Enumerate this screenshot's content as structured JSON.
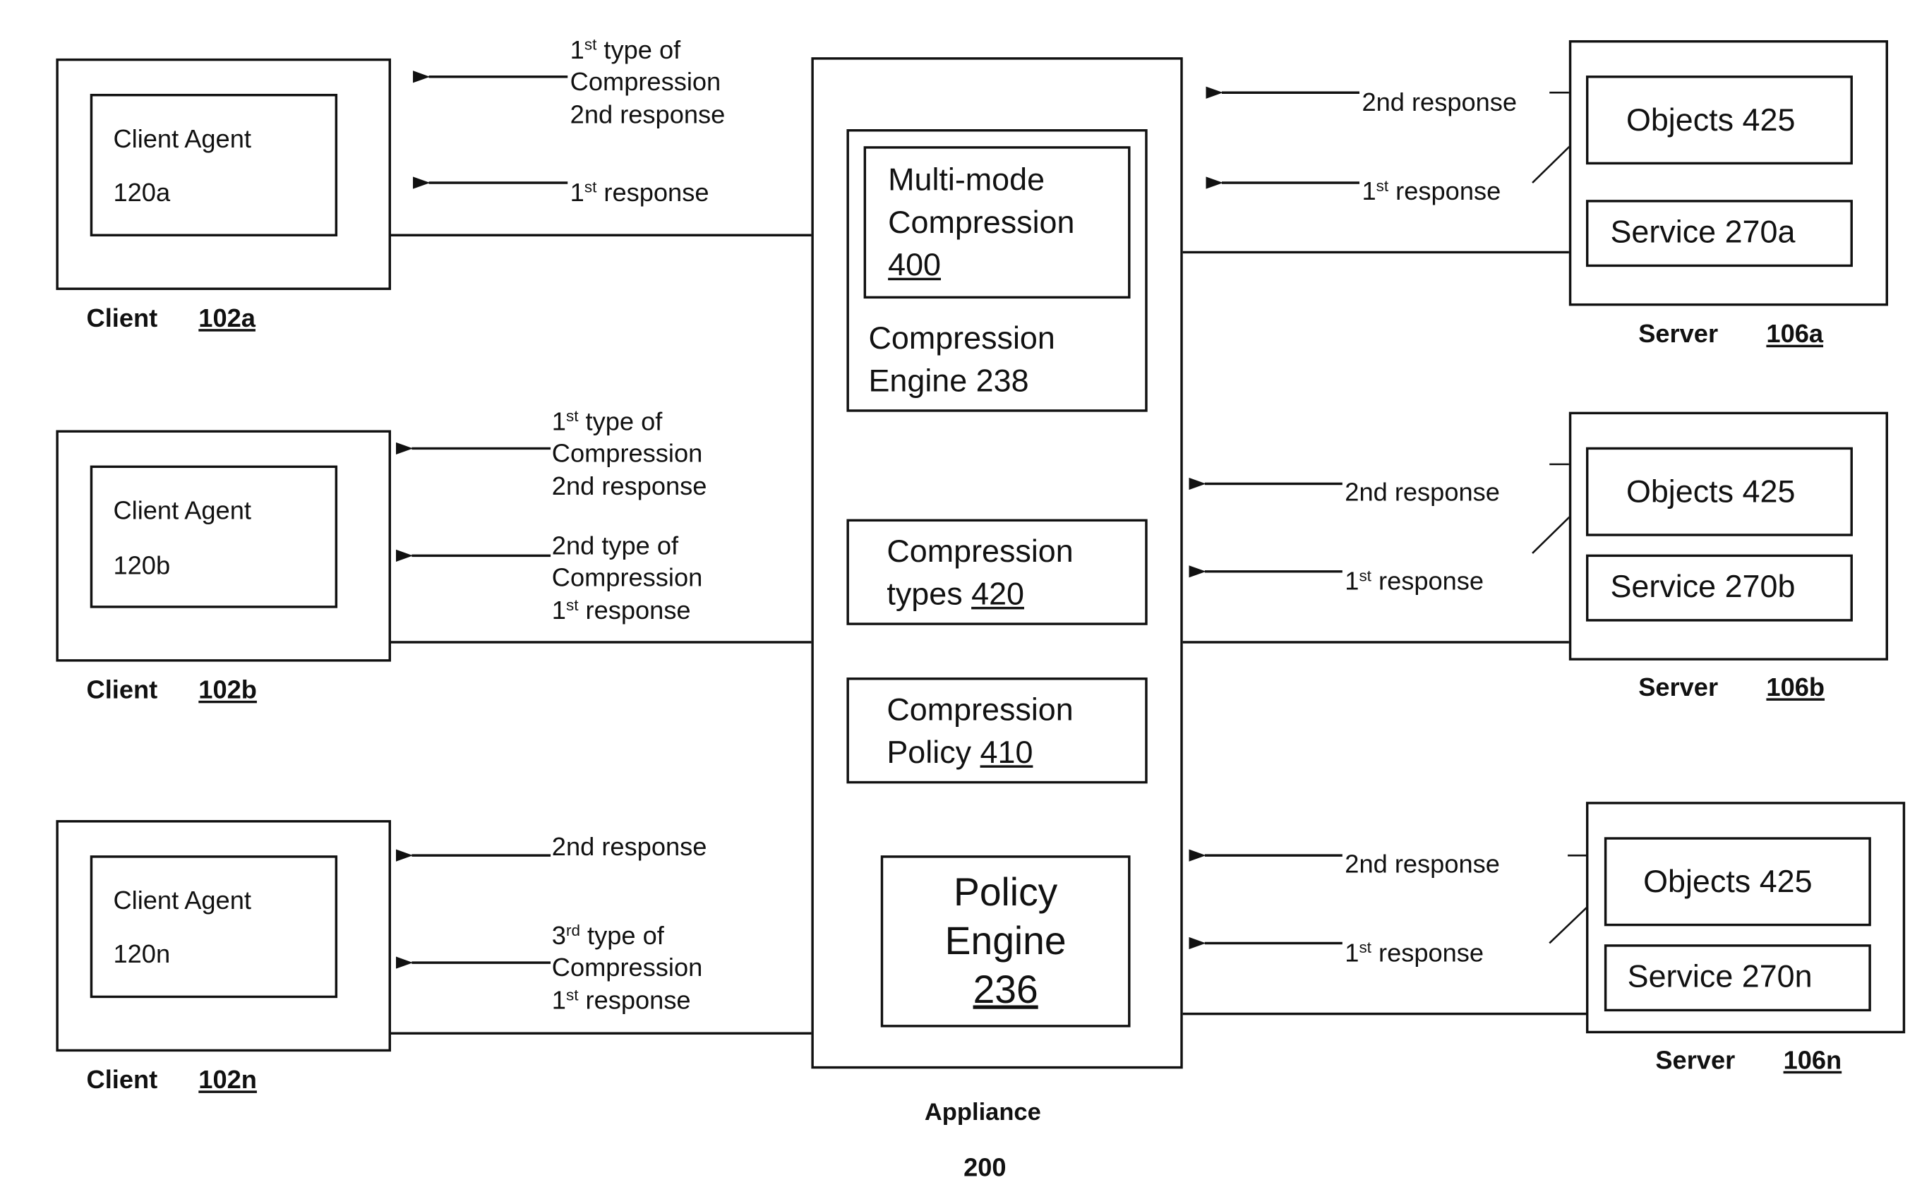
{
  "clients": [
    {
      "name": "Client",
      "ref": "102a",
      "agent": "Client Agent",
      "agent_ref": "120a",
      "arrows": [
        {
          "lines": [
            "1|st| type of",
            "Compression",
            "2nd response"
          ]
        },
        {
          "lines": [
            "1|st| response"
          ]
        }
      ]
    },
    {
      "name": "Client",
      "ref": "102b",
      "agent": "Client Agent",
      "agent_ref": "120b",
      "arrows": [
        {
          "lines": [
            "1|st| type of",
            "Compression",
            "2nd response"
          ]
        },
        {
          "lines": [
            "2nd type of",
            "Compression",
            "1|st| response"
          ]
        }
      ]
    },
    {
      "name": "Client",
      "ref": "102n",
      "agent": "Client Agent",
      "agent_ref": "120n",
      "arrows": [
        {
          "lines": [
            "2nd response"
          ]
        },
        {
          "lines": [
            "3|rd| type of",
            "Compression",
            "1|st| response"
          ]
        }
      ]
    }
  ],
  "appliance": {
    "label": "Appliance",
    "ref": "200",
    "compression_engine": {
      "line1": "Compression",
      "line2": "Engine 238"
    },
    "multimode": {
      "line1": "Multi-mode",
      "line2": "Compression",
      "ref": "400"
    },
    "types": {
      "line1": "Compression",
      "line2": "types ",
      "ref": "420"
    },
    "policy": {
      "line1": "Compression",
      "line2": "Policy ",
      "ref": "410"
    },
    "policy_engine": {
      "line1": "Policy",
      "line2": "Engine",
      "ref": "236"
    }
  },
  "servers": [
    {
      "name": "Server",
      "ref": "106a",
      "objects": "Objects 425",
      "service": "Service 270a",
      "arrows": [
        {
          "lines": [
            "2nd response"
          ]
        },
        {
          "lines": [
            "1|st| response"
          ]
        }
      ]
    },
    {
      "name": "Server",
      "ref": "106b",
      "objects": "Objects 425",
      "service": "Service 270b",
      "arrows": [
        {
          "lines": [
            "2nd response"
          ]
        },
        {
          "lines": [
            "1|st| response"
          ]
        }
      ]
    },
    {
      "name": "Server",
      "ref": "106n",
      "objects": "Objects 425",
      "service": "Service 270n",
      "arrows": [
        {
          "lines": [
            "2nd response"
          ]
        },
        {
          "lines": [
            "1|st| response"
          ]
        }
      ]
    }
  ]
}
